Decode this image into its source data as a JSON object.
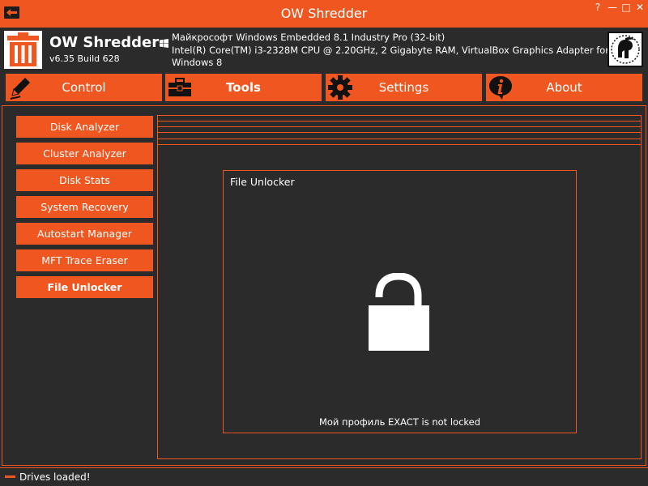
{
  "window": {
    "title": "OW Shredder",
    "controls": {
      "help": "?",
      "minimize": "—",
      "maximize": "□",
      "close": "✕"
    },
    "accent_color": "#f0561f",
    "background_color": "#2b2b2b"
  },
  "header": {
    "app_name": "OW Shredder",
    "version": "v6.35 Build 628",
    "os_line": "Майкрософт Windows Embedded 8.1 Industry Pro (32-bit)",
    "hw_line1": "Intel(R) Core(TM) i3-2328M CPU @ 2.20GHz, 2 Gigabyte RAM, VirtualBox Graphics Adapter for",
    "hw_line2": "Windows 8"
  },
  "tabs": [
    {
      "label": "Control",
      "icon": "pencil-icon",
      "active": false
    },
    {
      "label": "Tools",
      "icon": "toolbox-icon",
      "active": true
    },
    {
      "label": "Settings",
      "icon": "gear-icon",
      "active": false
    },
    {
      "label": "About",
      "icon": "info-icon",
      "active": false
    }
  ],
  "sidebar": {
    "items": [
      {
        "label": "Disk Analyzer",
        "active": false
      },
      {
        "label": "Cluster Analyzer",
        "active": false
      },
      {
        "label": "Disk Stats",
        "active": false
      },
      {
        "label": "System Recovery",
        "active": false
      },
      {
        "label": "Autostart Manager",
        "active": false
      },
      {
        "label": "MFT Trace Eraser",
        "active": false
      },
      {
        "label": "File Unlocker",
        "active": true
      }
    ]
  },
  "panel": {
    "title": "File Unlocker",
    "icon": "unlocked-padlock-icon",
    "status": "Мой профиль EXACT is not locked"
  },
  "statusbar": {
    "text": "Drives loaded!"
  }
}
